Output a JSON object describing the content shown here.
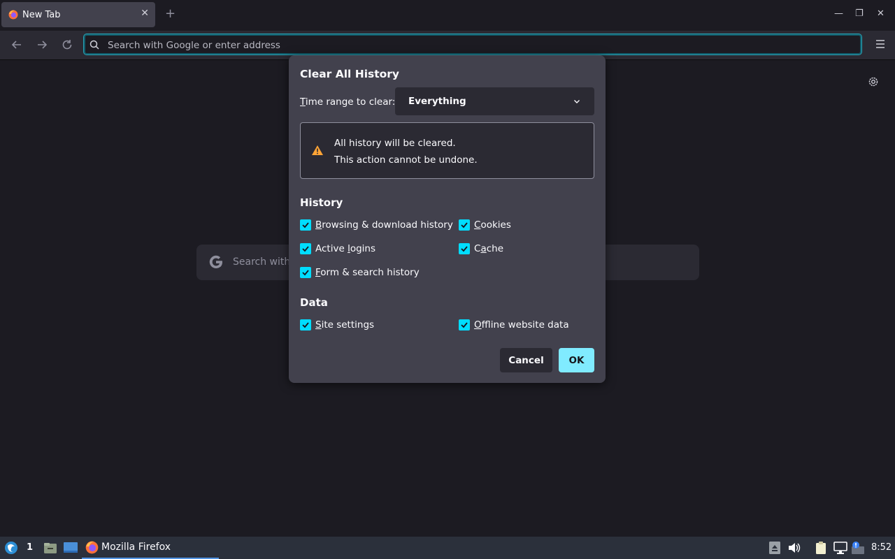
{
  "tab": {
    "title": "New Tab"
  },
  "urlbar": {
    "placeholder": "Search with Google or enter address"
  },
  "page": {
    "search_placeholder": "Search with"
  },
  "dialog": {
    "title": "Clear All History",
    "time_range_label": "ime range to clear:",
    "time_range_mnemonic": "T",
    "time_range_value": "Everything",
    "warning_line1": "All history will be cleared.",
    "warning_line2": "This action cannot be undone.",
    "history_heading": "History",
    "data_heading": "Data",
    "history_items": [
      {
        "mnemonic": "B",
        "rest": "rowsing & download history",
        "checked": true
      },
      {
        "mnemonic": "C",
        "rest": "ookies",
        "checked": true
      },
      {
        "pre": "Active ",
        "mnemonic": "l",
        "rest": "ogins",
        "checked": true
      },
      {
        "pre": "C",
        "mnemonic": "a",
        "rest": "che",
        "checked": true
      },
      {
        "mnemonic": "F",
        "rest": "orm & search history",
        "checked": true
      }
    ],
    "data_items": [
      {
        "mnemonic": "S",
        "rest": "ite settings",
        "checked": true
      },
      {
        "mnemonic": "O",
        "rest": "ffline website data",
        "checked": true
      }
    ],
    "cancel_label": "Cancel",
    "ok_label": "OK"
  },
  "taskbar": {
    "workspace": "1",
    "task_label": "Mozilla Firefox",
    "clock": "8:52"
  },
  "colors": {
    "accent": "#00ddff",
    "ok_button": "#80ebff",
    "dialog_bg": "#42414d",
    "page_bg": "#1c1b22"
  }
}
